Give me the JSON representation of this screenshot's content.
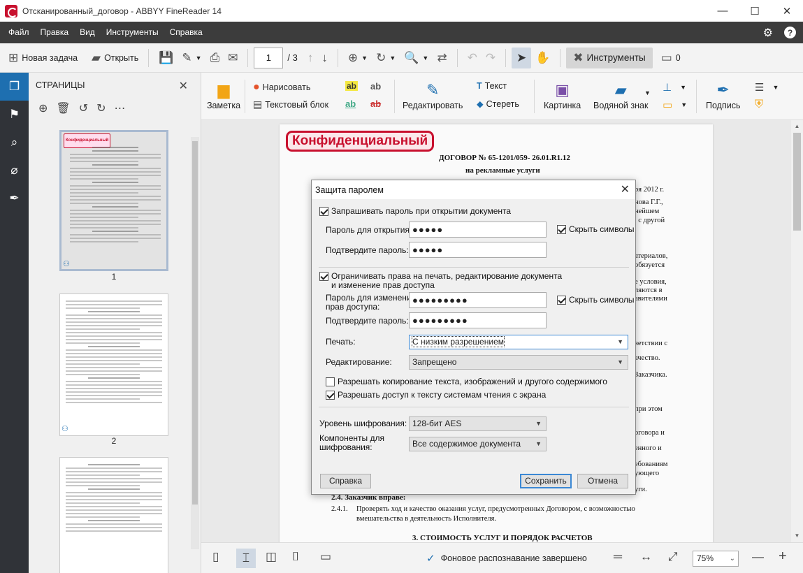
{
  "window": {
    "title": "Отсканированный_договор - ABBYY FineReader 14",
    "controls": [
      "—",
      "☐",
      "✕"
    ]
  },
  "menu": {
    "items": [
      "Файл",
      "Правка",
      "Вид",
      "Инструменты",
      "Справка"
    ]
  },
  "toolbar": {
    "new_task": "Новая задача",
    "open": "Открыть",
    "page_current": "1",
    "page_total": "/ 3",
    "tools": "Инструменты",
    "comments_count": "0"
  },
  "pages_panel": {
    "title": "СТРАНИЦЫ",
    "page_numbers": [
      "1",
      "2"
    ],
    "thumb_stamp": "Конфиденциальный"
  },
  "ribbon": {
    "note": "Заметка",
    "draw": "Нарисовать",
    "text_block": "Текстовый блок",
    "edit": "Редактировать",
    "text": "Текст",
    "erase": "Стереть",
    "picture": "Картинка",
    "watermark": "Водяной знак",
    "signature": "Подпись",
    "ab": "ab"
  },
  "document": {
    "stamp": "Конфиденциальный",
    "title": "ДОГОВОР № 65-1201/059-  26.01.R1.12",
    "subtitle": "на рекламные услуги",
    "right_fragments": [
      "ря 2012 г.",
      "нова Г.Г.,",
      "нейшем",
      ", с другой",
      "атериалов,",
      "обязуется",
      "е условия,",
      "ляются в",
      "авителями",
      "ветствии с",
      "ачество.",
      "Заказчика.",
      "при этом",
      "оговора и",
      "енного и",
      "ебованиям",
      "ующего",
      "уги."
    ],
    "clause_head": "2.4.  Заказчик вправе:",
    "clause_num": "2.4.1.",
    "clause_line1": "Проверять  ход  и  качество  оказания  услуг,  предусмотренных  Договором,  с  возможностью",
    "clause_line2": "вмешательства в деятельность Исполнителя.",
    "section3": "3.     СТОИМОСТЬ УСЛУГ И ПОРЯДОК РАСЧЕТОВ"
  },
  "statusbar": {
    "recognition_status": "Фоновое распознавание завершено",
    "zoom": "75%"
  },
  "dialog": {
    "title": "Защита паролем",
    "require_open_password": "Запрашивать пароль при открытии документа",
    "open_password_label": "Пароль для открытия:",
    "open_password_value": "●●●●●",
    "confirm_label": "Подтвердите пароль:",
    "confirm_open_value": "●●●●●",
    "hide_chars": "Скрыть символы",
    "restrict_rights_1": "Ограничивать права на печать, редактирование документа",
    "restrict_rights_2": "и изменение прав доступа",
    "perm_password_label_1": "Пароль для изменения",
    "perm_password_label_2": "прав доступа:",
    "perm_password_value": "●●●●●●●●●",
    "confirm_perm_value": "●●●●●●●●●",
    "print_label": "Печать:",
    "print_value": "С низким разрешением",
    "editing_label": "Редактирование:",
    "editing_value": "Запрещено",
    "allow_copy": "Разрешать копирование текста, изображений и другого содержимого",
    "allow_screen_reader": "Разрешать доступ к тексту системам чтения с экрана",
    "encryption_level_label": "Уровень шифрования:",
    "encryption_level_value": "128-бит AES",
    "encryption_components_label_1": "Компоненты для",
    "encryption_components_label_2": "шифрования:",
    "encryption_components_value": "Все содержимое документа",
    "help_button": "Справка",
    "save_button": "Сохранить",
    "cancel_button": "Отмена"
  }
}
